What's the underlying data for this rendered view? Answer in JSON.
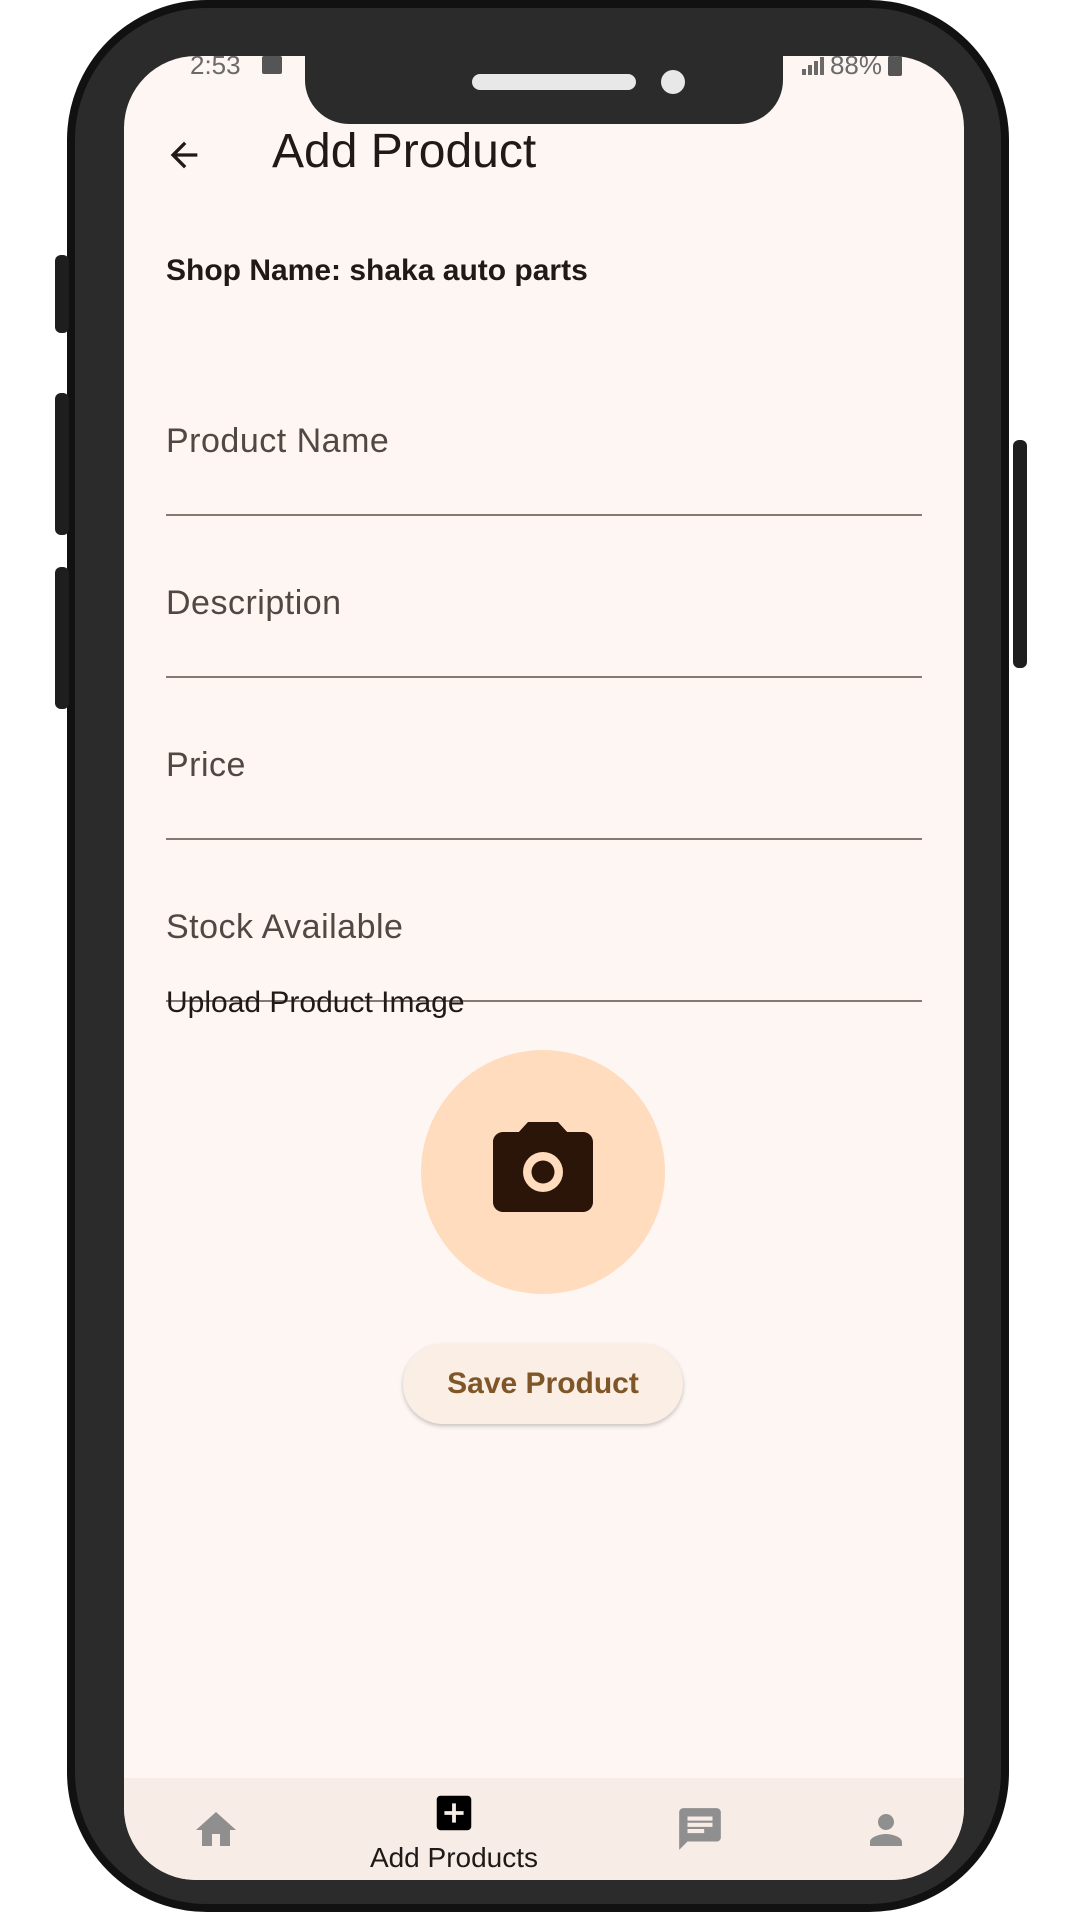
{
  "status_bar": {
    "time": "2:53",
    "battery": "88%"
  },
  "app_bar": {
    "title": "Add Product",
    "back_icon": "arrow-left-icon"
  },
  "form": {
    "shop_name": "Shop Name: shaka auto parts",
    "fields": [
      {
        "label": "Product Name"
      },
      {
        "label": "Description"
      },
      {
        "label": "Price"
      },
      {
        "label": "Stock Available"
      }
    ],
    "upload_label": "Upload Product Image",
    "upload_icon": "camera-icon",
    "save_label": "Save Product"
  },
  "bottom_nav": {
    "items": [
      {
        "icon": "home-icon",
        "label": ""
      },
      {
        "icon": "add-box-icon",
        "label": "Add Products",
        "selected": true
      },
      {
        "icon": "chat-icon",
        "label": ""
      },
      {
        "icon": "person-icon",
        "label": ""
      }
    ]
  },
  "colors": {
    "background": "#fdf6f3",
    "accent_circle": "#ffdcbe",
    "save_text": "#7e5627",
    "phone_frame": "#2b2b2b"
  }
}
